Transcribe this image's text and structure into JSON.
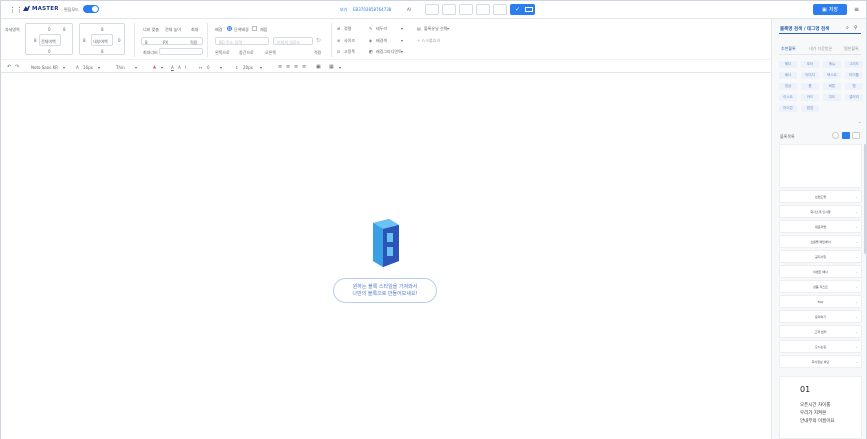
{
  "header": {
    "brand": "MASTER",
    "mode_label": "편집모드",
    "zoom_label": "보기",
    "doc_id": "EB3703858764738",
    "ai_label": "AI",
    "save_label": "저장"
  },
  "toolbar": {
    "align_label": "자세영역",
    "margin_center": "전체여백",
    "padding_center": "내부여백",
    "num0": "0",
    "num8": "8",
    "width_label": "너비 맞춤",
    "height_label": "전체 높이",
    "width_default": "최대",
    "px_unit": "PX",
    "fix_label": "적용",
    "max_width_label": "최대너비",
    "bg_label": "배경",
    "bg_radio1": "단색배경",
    "bg_radio2": "채움",
    "img_placeholder": "BG 주소 입력",
    "img_upload": "이미지 업로드",
    "pos1": "왼쪽으로",
    "pos2": "중간으로",
    "pos3": "오른쪽",
    "apply": "적용",
    "t1": "정렬",
    "t2": "사이즈",
    "t3": "고정폭",
    "t4": "테두리",
    "t5": "배경색",
    "t6": "배경그라디언트",
    "t7": "블록유닛 선택",
    "t8": "+ 스크롤효과"
  },
  "format": {
    "font": "Noto Sans KR",
    "size": "16px",
    "weight": "Thin",
    "spacing": "0",
    "line": "20px"
  },
  "canvas": {
    "bubble_line1": "원하는 블록 스타일을 가져와서",
    "bubble_line2": "나만의 블록으로 만들어보세요!"
  },
  "panel": {
    "search_title": "블록명 검색 / 태그명 검색",
    "tabs": [
      "추천블록",
      "내가 다운받은",
      "찜한블록"
    ],
    "chips": [
      "헤더",
      "푸터",
      "메뉴",
      "그리드",
      "배너",
      "이미지",
      "텍스트",
      "타이틀",
      "영상",
      "폼",
      "버튼",
      "탭",
      "리스트",
      "카드",
      "지도",
      "갤러리",
      "아이콘",
      "팝업"
    ],
    "section_label": "블록목록",
    "cards": [
      {
        "text": "브랜드명"
      },
      {
        "text": "회사소개 인사말"
      },
      {
        "text": "대표자명"
      },
      {
        "text": "쇼핑몰 메인배너"
      },
      {
        "text": "공지사항"
      },
      {
        "text": "이벤트 배너"
      },
      {
        "text": "상품 리스트"
      },
      {
        "text": "FAQ"
      },
      {
        "text": "문의하기"
      },
      {
        "text": "고객 센터"
      },
      {
        "text": "오시는길"
      },
      {
        "text": "회사정보 하단"
      }
    ],
    "big_num": "01",
    "big_line1": "오픈시간 차이를",
    "big_line2": "우리가 지켜본",
    "big_line3": "안내부의 이름이요"
  }
}
